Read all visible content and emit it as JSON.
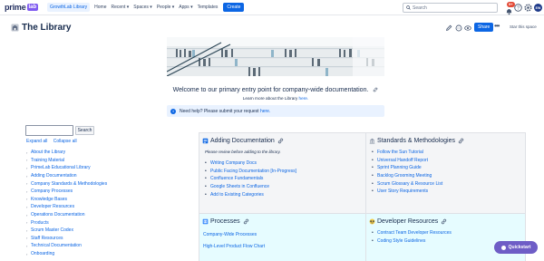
{
  "topnav": {
    "logo": "prime",
    "logo_badge": "lab",
    "items": [
      "GrowthLab Library",
      "Home",
      "Recent ▾",
      "Spaces ▾",
      "People ▾",
      "Apps ▾",
      "Templates"
    ],
    "create_label": "Create",
    "search_placeholder": "Search",
    "notification_count": "9+",
    "avatar_initials": "EW"
  },
  "page": {
    "title": "The Library",
    "share_label": "Share",
    "star_label": "Star this space"
  },
  "welcome": {
    "heading": "Welcome to our primary entry point for company-wide documentation.",
    "sub_prefix": "Learn more about the Library",
    "sub_link": "here."
  },
  "info": {
    "prefix": "Need help? Please submit your request",
    "link": "here."
  },
  "sidebar": {
    "search_button": "Search",
    "expand_all": "Expand all",
    "collapse_all": "Collapse all",
    "items": [
      "About the Library",
      "Training Material",
      "PrimeLab Educational Library",
      "Adding Documentation",
      "Company Standards & Methodologies",
      "Company Processes",
      "Knowledge Bases",
      "Developer Resources",
      "Operations Documentation",
      "Products",
      "Scrum Master Codex",
      "Staff Resources",
      "Technical Documentation",
      "Onboarding"
    ]
  },
  "sections": {
    "adding": {
      "title": "Adding Documentation",
      "note": "Please review before adding to the library.",
      "links": [
        "Writing Company Docs",
        "Public Facing Documentation [In-Progress]",
        "Confluence Fundamentals",
        "Google Sheets in Confluence",
        "Add to Existing Categories"
      ]
    },
    "standards": {
      "title": "Standards & Methodologies",
      "links": [
        "Follow the Sun Tutorial",
        "Universal Handoff Report",
        "Sprint Planning Guide",
        "Backlog Grooming Meeting",
        "Scrum Glossary & Resource List",
        "User Story Requirements"
      ]
    },
    "processes": {
      "title": "Processes",
      "links": [
        "Company-Wide Processes",
        "High-Level Product Flow Chart"
      ]
    },
    "developer": {
      "title": "Developer Resources",
      "links": [
        "Contract Team Developer Resources",
        "Coding Style Guidelines"
      ]
    }
  },
  "quickstart": "Quickstart",
  "colors": {
    "accent": "#0c66e4",
    "badge": "#7f5af0",
    "quickstart": "#6e5dc6",
    "info_bg": "#e9f2ff",
    "cell_cyan": "#e6fcff"
  }
}
